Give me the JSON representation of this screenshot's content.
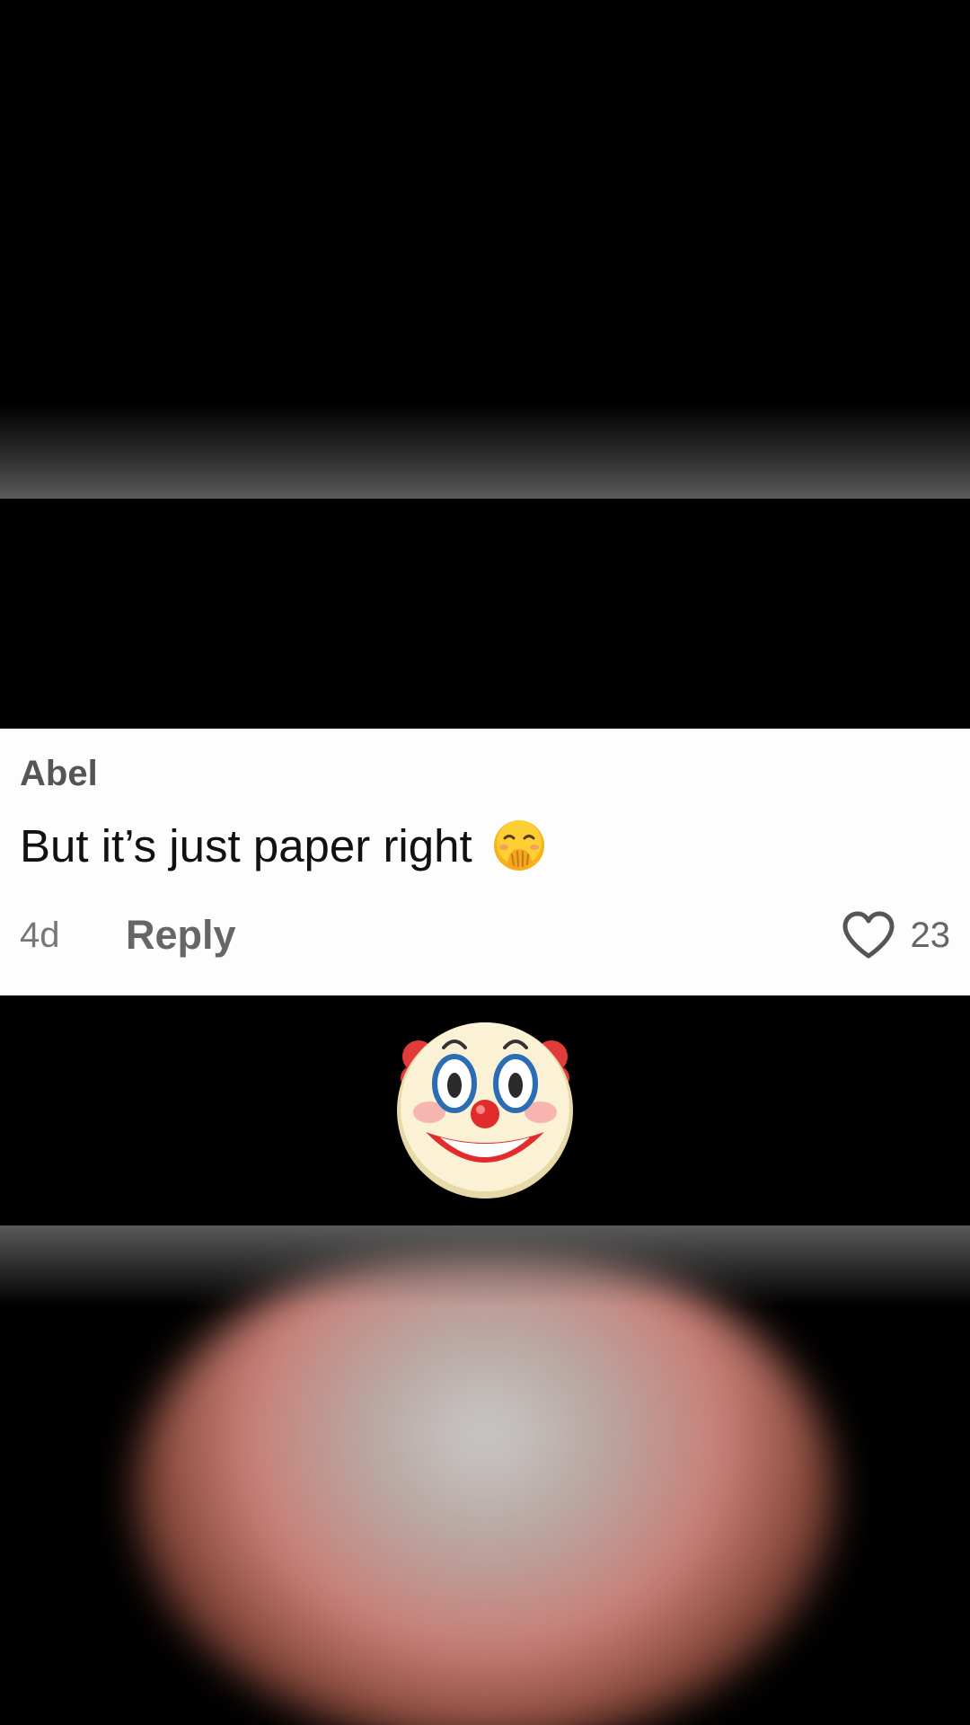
{
  "comment": {
    "username": "Abel",
    "text": "But it’s just paper right",
    "text_emoji": "face-with-hand-over-mouth-icon",
    "timestamp": "4d",
    "reply_label": "Reply",
    "like_count": "23"
  },
  "reaction_emoji": "clown-face-icon",
  "colors": {
    "background": "#000000",
    "card": "#fdfdfd",
    "username": "#555555",
    "text": "#111111",
    "meta": "#777777"
  }
}
